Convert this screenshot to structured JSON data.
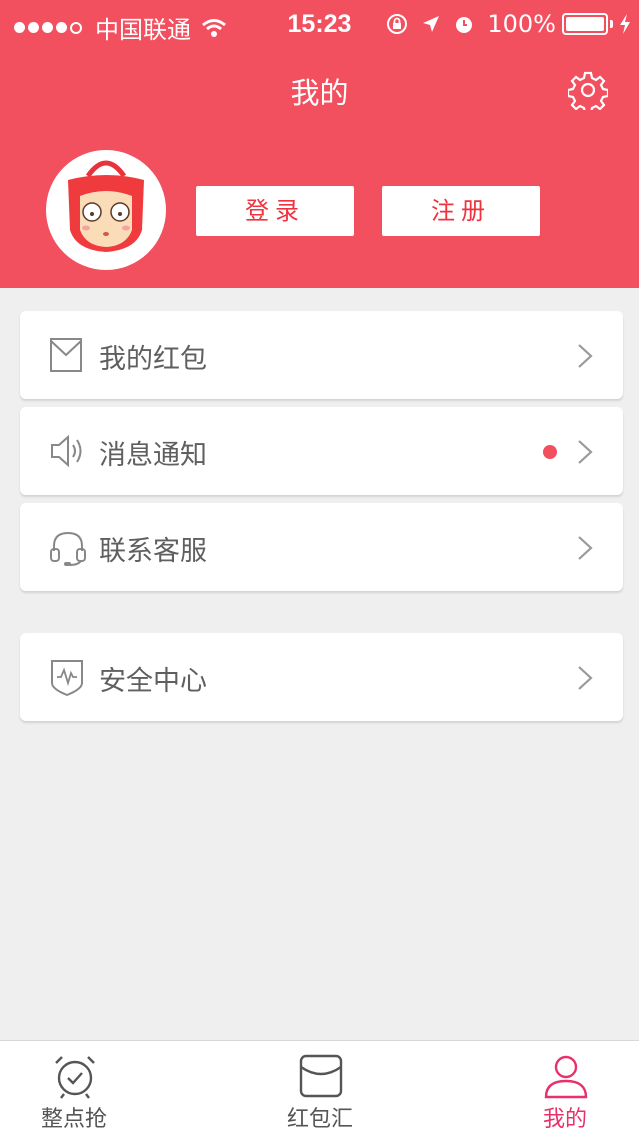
{
  "status_bar": {
    "carrier": "中国联通",
    "time": "15:23",
    "battery": "100%"
  },
  "header": {
    "title": "我的",
    "login_label": "登录",
    "register_label": "注册"
  },
  "menu": {
    "items": [
      {
        "label": "我的红包",
        "icon": "envelope-icon"
      },
      {
        "label": "消息通知",
        "icon": "speaker-icon",
        "badge": "red-dot"
      },
      {
        "label": "联系客服",
        "icon": "headset-icon"
      },
      {
        "label": "安全中心",
        "icon": "shield-icon"
      }
    ]
  },
  "tabbar": {
    "tabs": [
      {
        "label": "整点抢",
        "icon": "alarm-clock-icon"
      },
      {
        "label": "红包汇",
        "icon": "envelope-icon"
      },
      {
        "label": "我的",
        "icon": "person-icon",
        "active": true
      }
    ]
  },
  "colors": {
    "brand": "#f24f5f",
    "active_tab": "#e8316a",
    "button_text": "#f0323f"
  }
}
